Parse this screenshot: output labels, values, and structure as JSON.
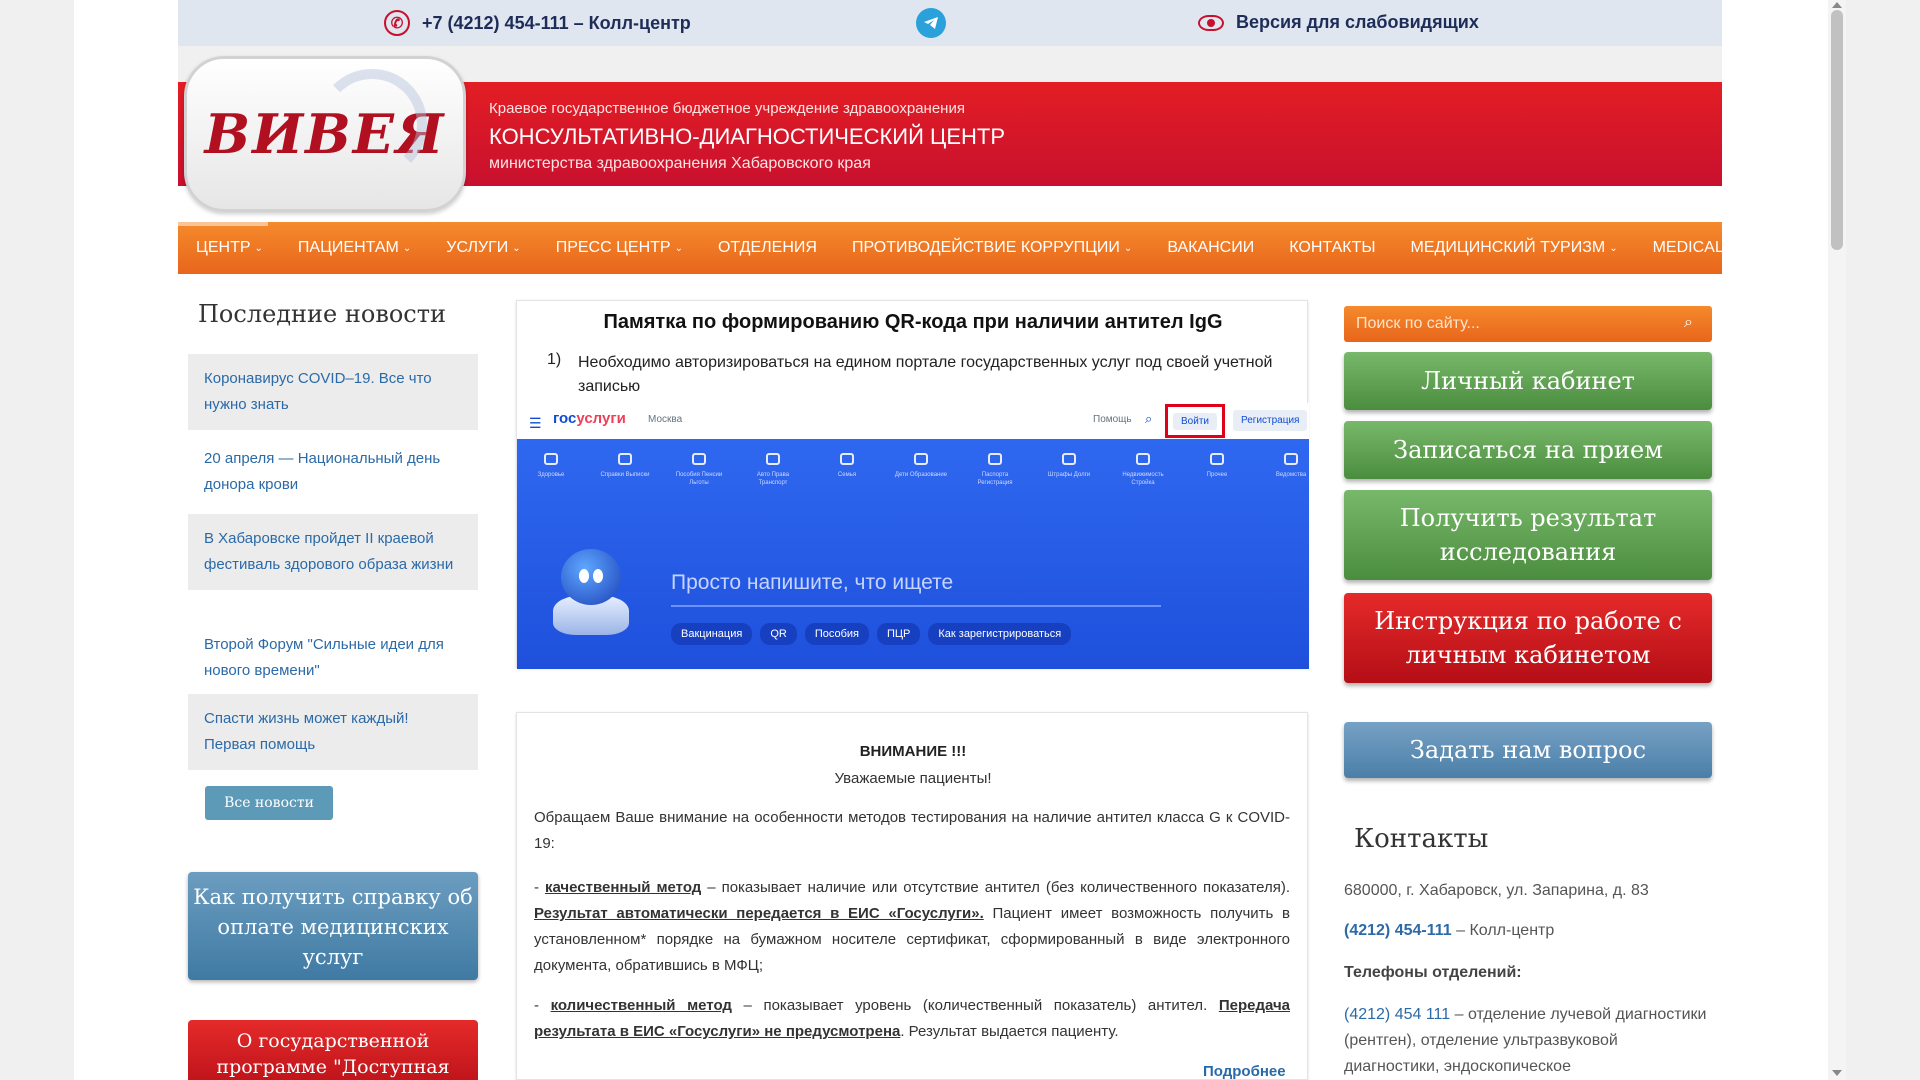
{
  "topbar": {
    "phone_text": "+7 (4212) 454-111 – Колл-центр",
    "vision_text": "Версия для слабовидящих",
    "colors": {
      "bg": "#dfe6ef",
      "accent": "#c8102e",
      "telegram": "#2aa1da"
    }
  },
  "header": {
    "logo_text": "ВИВЕЯ",
    "line1": "Краевое государственное бюджетное учреждение здравоохранения",
    "line2": "КОНСУЛЬТАТИВНО-ДИАГНОСТИЧЕСКИЙ ЦЕНТР",
    "line3": "министерства здравоохранения Хабаровского края",
    "color": "#e31e24"
  },
  "nav": {
    "color": "#f07a24",
    "items": [
      {
        "label": "ЦЕНТР",
        "dropdown": true
      },
      {
        "label": "ПАЦИЕНТАМ",
        "dropdown": true
      },
      {
        "label": "УСЛУГИ",
        "dropdown": true
      },
      {
        "label": "ПРЕСС ЦЕНТР",
        "dropdown": true
      },
      {
        "label": "ОТДЕЛЕНИЯ",
        "dropdown": false
      },
      {
        "label": "ПРОТИВОДЕЙСТВИЕ КОРРУПЦИИ",
        "dropdown": true
      },
      {
        "label": "ВАКАНСИИ",
        "dropdown": false
      },
      {
        "label": "КОНТАКТЫ",
        "dropdown": false
      },
      {
        "label": "МЕДИЦИНСКИЙ ТУРИЗМ",
        "dropdown": true
      },
      {
        "label": "MEDICAL TOURISM",
        "dropdown": true
      }
    ]
  },
  "news": {
    "title": "Последние новости",
    "items": [
      "Коронавирус COVID–19. Все что нужно знать",
      "20 апреля — Национальный день донора крови",
      "В Хабаровске пройдет II краевой фестиваль здорового образа жизни",
      "Второй Форум \"Сильные идеи для нового времени\"",
      "Спасти жизнь может каждый! Первая помощь"
    ],
    "all_button": "Все новости"
  },
  "promos": {
    "blue": "Как получить справку об оплате медицинских услуг",
    "red": "О государственной программе \"Доступная"
  },
  "memo": {
    "title": "Памятка по формированию QR-кода при наличии антител IgG",
    "step_num": "1)",
    "step_text": "Необходимо авторизироваться на едином портале государственных услуг под своей учетной записью",
    "gosuslugi": {
      "logo_a": "гос",
      "logo_b": "услуги",
      "city": "Москва",
      "help": "Помощь",
      "login": "Войти",
      "register": "Регистрация",
      "categories": [
        "Здоровье",
        "Справки Выписки",
        "Пособия Пенсии Льготы",
        "Авто Права Транспорт",
        "Семья",
        "Дети Образование",
        "Паспорта Регистрация",
        "Штрафы Долги",
        "Недвижимость Стройка",
        "Прочее",
        "Ведомства"
      ],
      "placeholder": "Просто напишите, что ищете",
      "chips": [
        "Вакцинация",
        "QR",
        "Пособия",
        "ПЦР",
        "Как зарегистрироваться"
      ]
    }
  },
  "notice": {
    "attention": "ВНИМАНИЕ !!!",
    "dear": "Уважаемые пациенты!",
    "p1": "Обращаем Ваше внимание на особенности методов тестирования на наличие антител класса G к COVID-19:",
    "p2_dash": "- ",
    "p2_method": "качественный метод",
    "p2_a": " – показывает наличие или отсутствие антител (без количественного показателя). ",
    "p2_result": "Результат автоматически передается в ЕИС «Госуслуги».",
    "p2_b": " Пациент имеет возможность получить в установленном* порядке на бумажном носителе сертификат, сформированный в виде электронного документа, обратившись в МФЦ;",
    "p3_dash": "- ",
    "p3_method": "количественный метод",
    "p3_a": " – показывает уровень (количественный показатель) антител. ",
    "p3_transfer": "Передача результата в ЕИС «Госуслуги» не предусмотрена",
    "p3_b": ". Результат выдается пациенту.",
    "more": "Подробнее"
  },
  "sidebar": {
    "search_placeholder": "Поиск по сайту...",
    "buttons": [
      "Личный кабинет",
      "Записаться на прием",
      "Получить результат исследования",
      "Инструкция по работе с личным кабинетом",
      "Задать нам вопрос"
    ],
    "contacts": {
      "title": "Контакты",
      "address": "680000, г. Хабаровск, ул. Запарина, д. 83",
      "phone": "(4212) 454-111",
      "phone_suffix": " – Колл-центр",
      "deps_label": "Телефоны отделений:",
      "dep_phone": "(4212) 454 111",
      "dep_text": " – отделение лучевой диагностики (рентген), отделение ультразвуковой диагностики, эндоскопическое"
    }
  }
}
